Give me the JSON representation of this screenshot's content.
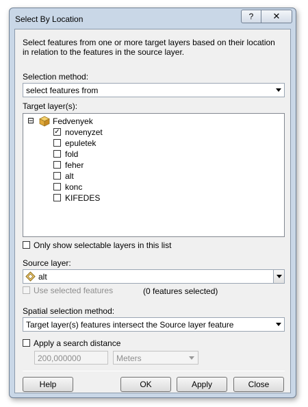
{
  "window": {
    "title": "Select By Location",
    "help_symbol": "?",
    "close_symbol": "✕"
  },
  "description": "Select features from one or more target layers based on their location in relation to the features in the source layer.",
  "selection_method": {
    "label": "Selection method:",
    "value": "select features from"
  },
  "target_layers": {
    "label": "Target layer(s):",
    "group": {
      "name": "Fedvenyek",
      "expander": "⊟"
    },
    "layers": [
      {
        "name": "novenyzet",
        "checked": true
      },
      {
        "name": "epuletek",
        "checked": false
      },
      {
        "name": "fold",
        "checked": false
      },
      {
        "name": "feher",
        "checked": false
      },
      {
        "name": "alt",
        "checked": false
      },
      {
        "name": "konc",
        "checked": false
      },
      {
        "name": "KIFEDES",
        "checked": false
      }
    ],
    "check_mark": "✓"
  },
  "only_selectable": {
    "label": "Only show selectable layers in this list",
    "checked": false
  },
  "source_layer": {
    "label": "Source layer:",
    "value": "alt"
  },
  "use_selected": {
    "label": "Use selected features",
    "enabled": false,
    "count_text": "(0 features selected)"
  },
  "spatial_method": {
    "label": "Spatial selection method:",
    "value": "Target layer(s) features intersect the Source layer feature"
  },
  "search_distance": {
    "label": "Apply a search distance",
    "checked": false,
    "value": "200,000000",
    "unit": "Meters"
  },
  "buttons": {
    "help": "Help",
    "ok": "OK",
    "apply": "Apply",
    "close": "Close"
  }
}
